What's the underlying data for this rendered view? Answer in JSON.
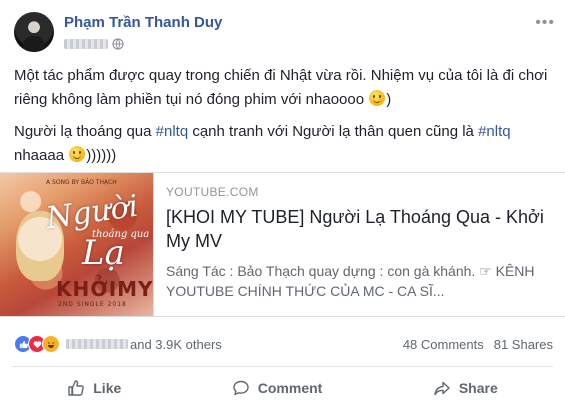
{
  "post": {
    "author": "Phạm Trần Thanh Duy",
    "menu_icon": "ellipsis-icon",
    "privacy_icon": "globe-icon",
    "paragraphs": [
      {
        "before": "Một tác phẩm được quay trong chiến đi Nhật vừa rồi. Nhiệm vụ của tôi là đi chơi riêng không làm phiền tụi nó đóng phim với nhaoooo ",
        "after": ")"
      },
      {
        "lead": "Người lạ thoáng qua ",
        "tag1": "#nltq",
        "middle": " cạnh tranh với Người lạ thân quen cũng là ",
        "tag2": "#nltq",
        "tail": " nhaaaa ",
        "after": "))))))"
      }
    ]
  },
  "link_preview": {
    "domain": "YOUTUBE.COM",
    "title": "[KHOI MY TUBE] Người Lạ Thoáng Qua - Khởi My MV",
    "description": "Sáng Tác : Bảo Thạch quay dựng : con gà khánh. ☞ KÊNH YOUTUBE CHÍNH THỨC CỦA MC - CA SĨ...",
    "thumbnail": {
      "top_credit": "A SONG BY BẢO THẠCH",
      "script_word": "Người",
      "script_small": "thoáng qua",
      "script_big": "Lạ",
      "brand": "KHỞIMY",
      "single": "2ND SINGLE 2018"
    }
  },
  "reactions": {
    "types": [
      "like",
      "love",
      "haha"
    ],
    "others_text": "and 3.9K others",
    "comments": "48 Comments",
    "shares": "81 Shares"
  },
  "actions": {
    "like": "Like",
    "comment": "Comment",
    "share": "Share"
  },
  "colors": {
    "link_blue": "#365899",
    "secondary_text": "#606770",
    "primary_text": "#1d2129"
  }
}
